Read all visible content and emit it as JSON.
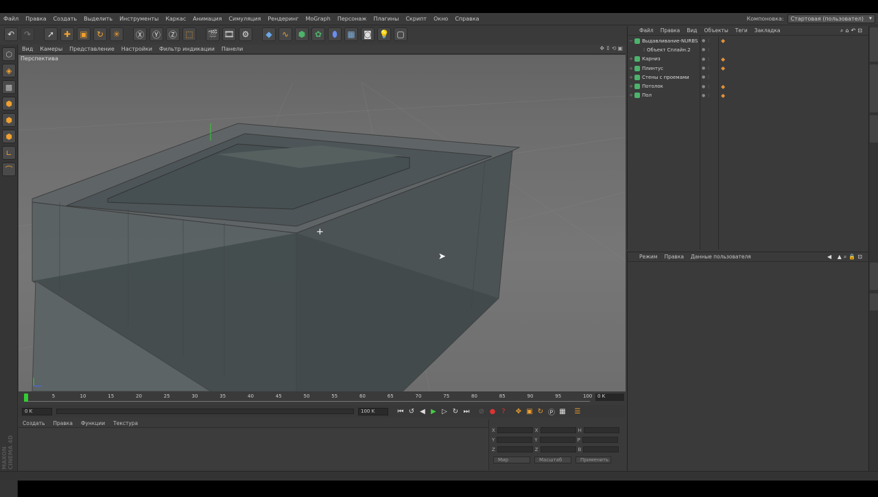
{
  "menubar": {
    "items": [
      "Файл",
      "Правка",
      "Создать",
      "Выделить",
      "Инструменты",
      "Каркас",
      "Анимация",
      "Симуляция",
      "Рендеринг",
      "MoGraph",
      "Персонаж",
      "Плагины",
      "Скрипт",
      "Окно",
      "Справка"
    ],
    "layout_label": "Компоновка:",
    "layout_value": "Стартовая (пользовател)"
  },
  "toolbar": {
    "icons": [
      "undo-icon",
      "redo-icon",
      "select-icon",
      "move-icon",
      "scale-icon",
      "rotate-icon",
      "add-icon",
      "x-axis-icon",
      "y-axis-icon",
      "z-axis-icon",
      "coord-icon",
      "render-view-icon",
      "render-icon",
      "render-settings-icon",
      "cube-icon",
      "spline-icon",
      "nurbs-icon",
      "array-icon",
      "deformer-icon",
      "floor-icon",
      "camera-icon",
      "light-icon",
      "display-icon"
    ]
  },
  "viewport": {
    "menu": [
      "Вид",
      "Камеры",
      "Представление",
      "Настройки",
      "Фильтр индикации",
      "Панели"
    ],
    "label": "Перспектива"
  },
  "timeline": {
    "ticks": [
      "0",
      "5",
      "10",
      "15",
      "20",
      "25",
      "30",
      "35",
      "40",
      "45",
      "50",
      "55",
      "60",
      "65",
      "70",
      "75",
      "80",
      "85",
      "90",
      "95",
      "100"
    ],
    "current_frame": "0 K",
    "start_field": "0 K",
    "end_field": "100 K"
  },
  "materials": {
    "menu": [
      "Создать",
      "Правка",
      "Функции",
      "Текстура"
    ]
  },
  "coords": {
    "axes_left": [
      "X",
      "Y",
      "Z"
    ],
    "axes_mid": [
      "X",
      "Y",
      "Z"
    ],
    "axes_right": [
      "H",
      "P",
      "B"
    ],
    "mode1": "Мир",
    "mode2": "Масштаб",
    "apply": "Применить"
  },
  "objects": {
    "menu": [
      "Файл",
      "Правка",
      "Вид",
      "Объекты",
      "Теги",
      "Закладка"
    ],
    "items": [
      {
        "name": "Выдавливание-NURBS",
        "indent": false
      },
      {
        "name": "Объект Сплайн.2",
        "indent": true
      },
      {
        "name": "Карниз",
        "indent": false
      },
      {
        "name": "Плинтус",
        "indent": false
      },
      {
        "name": "Стены с проемами",
        "indent": false
      },
      {
        "name": "Потолок",
        "indent": false
      },
      {
        "name": "Пол",
        "indent": false
      }
    ]
  },
  "attributes": {
    "menu": [
      "Режим",
      "Правка",
      "Данные пользователя"
    ]
  },
  "brand": "MAXON CINEMA 4D",
  "colors": {
    "accent_green": "#4db36c",
    "tag_orange": "#e3913a",
    "bg": "#3a3a3a"
  }
}
